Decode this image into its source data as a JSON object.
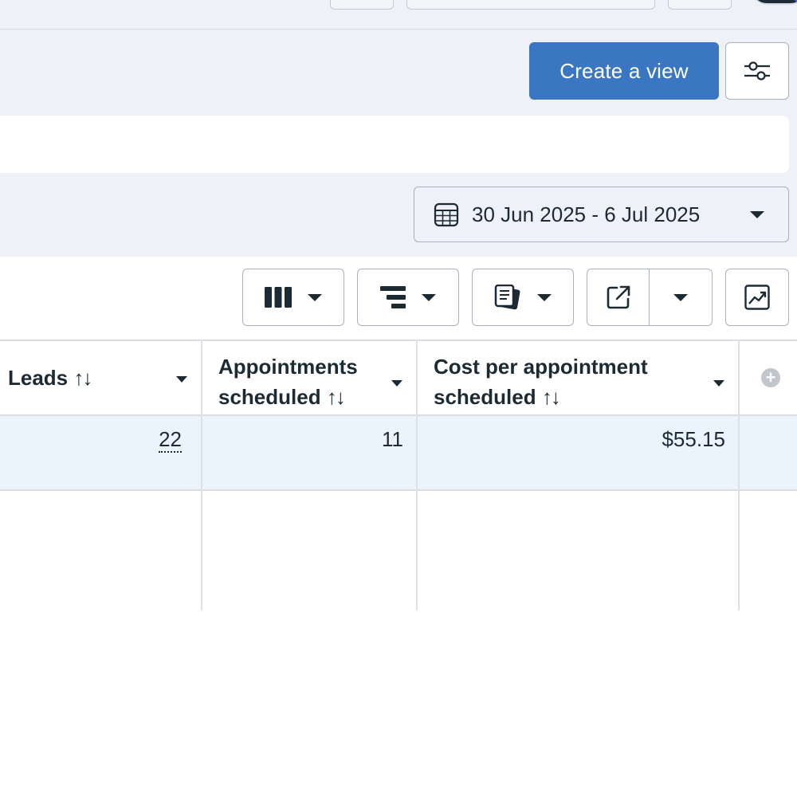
{
  "header": {
    "create_view_label": "Create a view",
    "settings_icon": "sliders-icon"
  },
  "date_range": {
    "icon": "calendar-icon",
    "label": "30 Jun 2025 - 6 Jul 2025"
  },
  "toolbar": {
    "icons": [
      "columns-icon",
      "breakdown-icon",
      "reports-icon",
      "export-icon",
      "chart-icon"
    ]
  },
  "table": {
    "columns": [
      {
        "line1": "Leads",
        "line2": "",
        "sort_icon": "↑↓"
      },
      {
        "line1": "Appointments",
        "line2": "scheduled",
        "sort_icon": "↑↓"
      },
      {
        "line1": "Cost per appointment",
        "line2": "scheduled",
        "sort_icon": "↑↓"
      }
    ],
    "rows": [
      {
        "leads": "22",
        "appointments_scheduled": "11",
        "cost_per_appointment_scheduled": "$55.15"
      }
    ],
    "add_column_icon": "plus-circle-icon"
  }
}
